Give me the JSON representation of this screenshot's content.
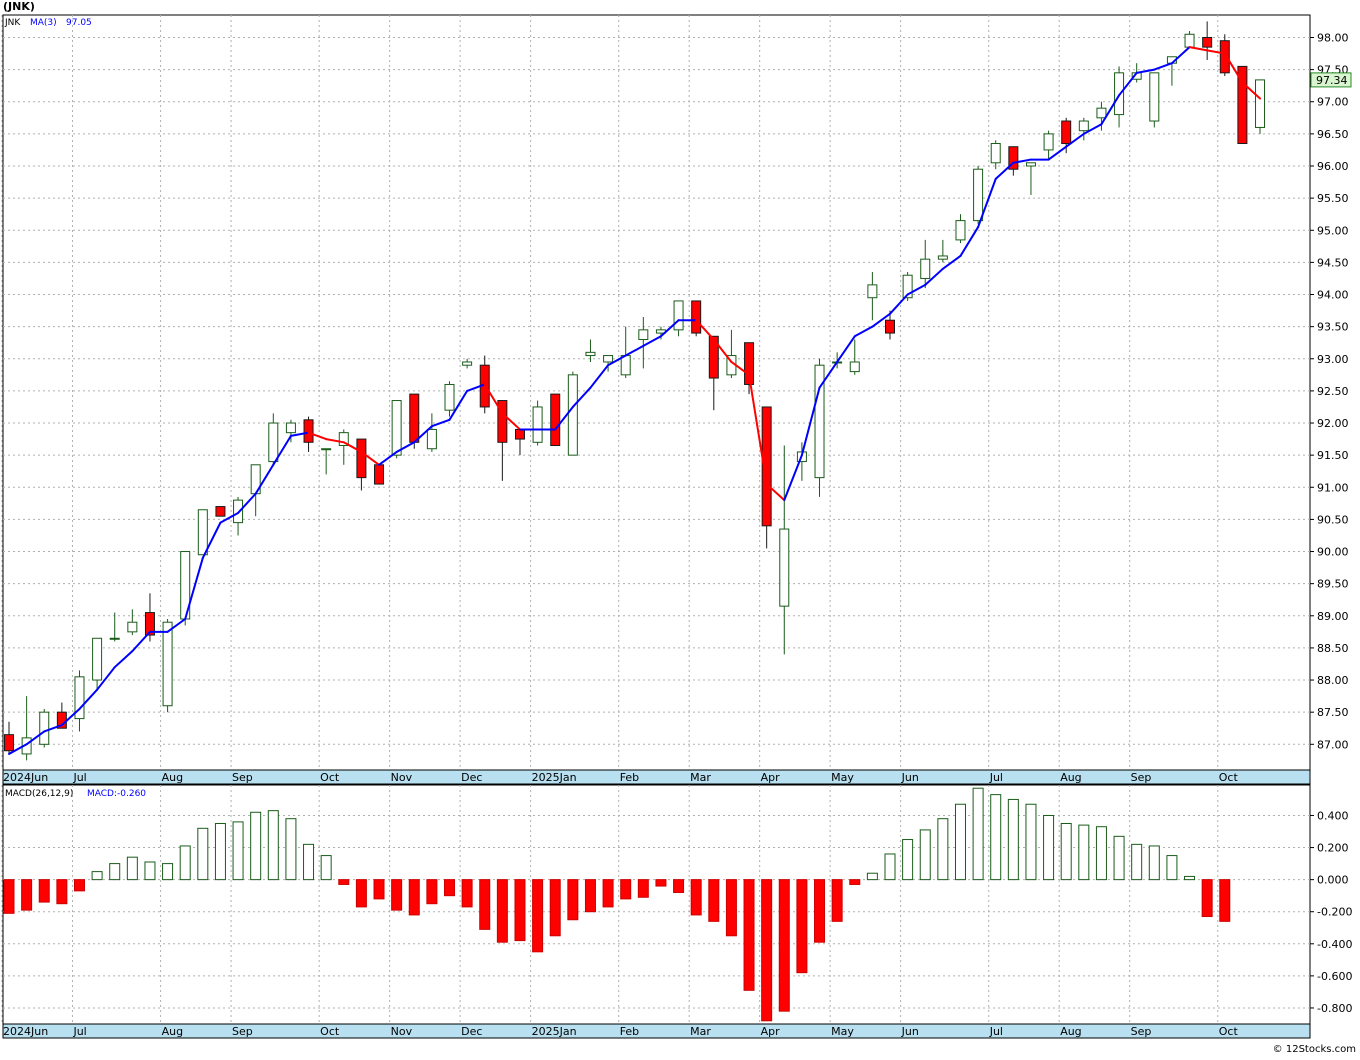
{
  "header": {
    "title": "(JNK)"
  },
  "credit": "© 12Stocks.com",
  "price_panel": {
    "legend_symbol": "JNK",
    "legend_ma": "MA(3)",
    "legend_ma_value": "97.05",
    "last_price_label": "97.34"
  },
  "macd_panel": {
    "legend_macd": "MACD(26,12,9)",
    "legend_value": "MACD:-0.260"
  },
  "colors": {
    "up_body": "#ffffff",
    "up_border": "#1a5c1a",
    "down_body": "#ff0000",
    "down_border": "#1a1a1a",
    "ma_up": "#0000ff",
    "ma_down": "#ff0000",
    "axis_strip": "#b8e0f0",
    "grid": "#b0b0b0",
    "last_price_bg": "#d8f5d0"
  },
  "time_axis": {
    "labels": [
      "2024Jun",
      "Jul",
      "Aug",
      "Sep",
      "Oct",
      "Nov",
      "Dec",
      "2025Jan",
      "Feb",
      "Mar",
      "Apr",
      "May",
      "Jun",
      "Jul",
      "Aug",
      "Sep",
      "Oct"
    ],
    "label_week_index": [
      0,
      4,
      9,
      13,
      18,
      22,
      26,
      30,
      35,
      39,
      43,
      47,
      51,
      56,
      60,
      64,
      69
    ]
  },
  "chart_data": [
    {
      "type": "candlestick",
      "title": "(JNK)",
      "series_name": "JNK",
      "period": "weekly",
      "ylim": [
        86.6,
        98.35
      ],
      "y_ticks": [
        "87.00",
        "87.50",
        "88.00",
        "88.50",
        "89.00",
        "89.50",
        "90.00",
        "90.50",
        "91.00",
        "91.50",
        "92.00",
        "92.50",
        "93.00",
        "93.50",
        "94.00",
        "94.50",
        "95.00",
        "95.50",
        "96.00",
        "96.50",
        "97.00",
        "97.50",
        "98.00"
      ],
      "grid": true,
      "candles": [
        {
          "o": 87.15,
          "h": 87.35,
          "l": 86.85,
          "c": 86.9
        },
        {
          "o": 86.85,
          "h": 87.75,
          "l": 86.75,
          "c": 87.1
        },
        {
          "o": 87.0,
          "h": 87.55,
          "l": 86.95,
          "c": 87.5
        },
        {
          "o": 87.5,
          "h": 87.65,
          "l": 87.25,
          "c": 87.25
        },
        {
          "o": 87.4,
          "h": 88.15,
          "l": 87.2,
          "c": 88.05
        },
        {
          "o": 88.0,
          "h": 88.65,
          "l": 87.85,
          "c": 88.65
        },
        {
          "o": 88.65,
          "h": 89.05,
          "l": 88.6,
          "c": 88.65
        },
        {
          "o": 88.75,
          "h": 89.1,
          "l": 88.7,
          "c": 88.9
        },
        {
          "o": 89.05,
          "h": 89.35,
          "l": 88.6,
          "c": 88.7
        },
        {
          "o": 87.6,
          "h": 88.95,
          "l": 87.5,
          "c": 88.9
        },
        {
          "o": 88.95,
          "h": 90.0,
          "l": 88.85,
          "c": 90.0
        },
        {
          "o": 89.95,
          "h": 90.65,
          "l": 89.95,
          "c": 90.65
        },
        {
          "o": 90.7,
          "h": 90.7,
          "l": 90.55,
          "c": 90.55
        },
        {
          "o": 90.45,
          "h": 90.85,
          "l": 90.25,
          "c": 90.8
        },
        {
          "o": 90.9,
          "h": 91.35,
          "l": 90.55,
          "c": 91.35
        },
        {
          "o": 91.4,
          "h": 92.15,
          "l": 91.35,
          "c": 92.0
        },
        {
          "o": 91.85,
          "h": 92.05,
          "l": 91.7,
          "c": 92.0
        },
        {
          "o": 92.05,
          "h": 92.1,
          "l": 91.55,
          "c": 91.7
        },
        {
          "o": 91.6,
          "h": 91.6,
          "l": 91.2,
          "c": 91.6
        },
        {
          "o": 91.65,
          "h": 91.9,
          "l": 91.35,
          "c": 91.85
        },
        {
          "o": 91.75,
          "h": 91.75,
          "l": 90.95,
          "c": 91.15
        },
        {
          "o": 91.35,
          "h": 91.35,
          "l": 91.05,
          "c": 91.05
        },
        {
          "o": 91.5,
          "h": 92.35,
          "l": 91.45,
          "c": 92.35
        },
        {
          "o": 92.45,
          "h": 92.45,
          "l": 91.6,
          "c": 91.7
        },
        {
          "o": 91.6,
          "h": 92.15,
          "l": 91.55,
          "c": 91.9
        },
        {
          "o": 92.2,
          "h": 92.65,
          "l": 92.1,
          "c": 92.6
        },
        {
          "o": 92.9,
          "h": 93.0,
          "l": 92.85,
          "c": 92.95
        },
        {
          "o": 92.9,
          "h": 93.05,
          "l": 92.15,
          "c": 92.25
        },
        {
          "o": 92.35,
          "h": 92.35,
          "l": 91.1,
          "c": 91.7
        },
        {
          "o": 91.9,
          "h": 91.9,
          "l": 91.5,
          "c": 91.75
        },
        {
          "o": 91.7,
          "h": 92.35,
          "l": 91.65,
          "c": 92.25
        },
        {
          "o": 92.45,
          "h": 92.45,
          "l": 91.65,
          "c": 91.65
        },
        {
          "o": 91.5,
          "h": 92.8,
          "l": 91.5,
          "c": 92.75
        },
        {
          "o": 93.05,
          "h": 93.3,
          "l": 92.95,
          "c": 93.1
        },
        {
          "o": 92.95,
          "h": 93.05,
          "l": 92.8,
          "c": 93.05
        },
        {
          "o": 92.75,
          "h": 93.5,
          "l": 92.7,
          "c": 93.05
        },
        {
          "o": 93.3,
          "h": 93.65,
          "l": 92.85,
          "c": 93.45
        },
        {
          "o": 93.4,
          "h": 93.5,
          "l": 93.3,
          "c": 93.45
        },
        {
          "o": 93.45,
          "h": 93.9,
          "l": 93.35,
          "c": 93.9
        },
        {
          "o": 93.9,
          "h": 93.9,
          "l": 93.35,
          "c": 93.4
        },
        {
          "o": 93.35,
          "h": 93.35,
          "l": 92.2,
          "c": 92.7
        },
        {
          "o": 92.75,
          "h": 93.45,
          "l": 92.7,
          "c": 93.05
        },
        {
          "o": 93.25,
          "h": 93.25,
          "l": 92.45,
          "c": 92.6
        },
        {
          "o": 92.25,
          "h": 92.25,
          "l": 90.05,
          "c": 90.4
        },
        {
          "o": 89.15,
          "h": 91.65,
          "l": 88.4,
          "c": 90.35
        },
        {
          "o": 91.4,
          "h": 91.7,
          "l": 91.1,
          "c": 91.55
        },
        {
          "o": 91.15,
          "h": 93.0,
          "l": 90.85,
          "c": 92.9
        },
        {
          "o": 92.95,
          "h": 93.1,
          "l": 92.85,
          "c": 92.95
        },
        {
          "o": 92.8,
          "h": 93.3,
          "l": 92.75,
          "c": 92.95
        },
        {
          "o": 93.95,
          "h": 94.35,
          "l": 93.6,
          "c": 94.15
        },
        {
          "o": 93.6,
          "h": 93.75,
          "l": 93.3,
          "c": 93.4
        },
        {
          "o": 93.95,
          "h": 94.35,
          "l": 93.9,
          "c": 94.3
        },
        {
          "o": 94.25,
          "h": 94.85,
          "l": 94.1,
          "c": 94.55
        },
        {
          "o": 94.55,
          "h": 94.85,
          "l": 94.5,
          "c": 94.6
        },
        {
          "o": 94.85,
          "h": 95.25,
          "l": 94.8,
          "c": 95.15
        },
        {
          "o": 95.15,
          "h": 96.0,
          "l": 95.1,
          "c": 95.95
        },
        {
          "o": 96.05,
          "h": 96.4,
          "l": 95.95,
          "c": 96.35
        },
        {
          "o": 96.3,
          "h": 96.3,
          "l": 95.85,
          "c": 95.95
        },
        {
          "o": 96.0,
          "h": 96.05,
          "l": 95.55,
          "c": 96.05
        },
        {
          "o": 96.25,
          "h": 96.55,
          "l": 96.1,
          "c": 96.5
        },
        {
          "o": 96.7,
          "h": 96.75,
          "l": 96.2,
          "c": 96.35
        },
        {
          "o": 96.55,
          "h": 96.75,
          "l": 96.4,
          "c": 96.7
        },
        {
          "o": 96.75,
          "h": 97.0,
          "l": 96.55,
          "c": 96.9
        },
        {
          "o": 96.8,
          "h": 97.55,
          "l": 96.6,
          "c": 97.45
        },
        {
          "o": 97.35,
          "h": 97.6,
          "l": 97.3,
          "c": 97.45
        },
        {
          "o": 96.7,
          "h": 97.45,
          "l": 96.6,
          "c": 97.45
        },
        {
          "o": 97.6,
          "h": 97.7,
          "l": 97.25,
          "c": 97.7
        },
        {
          "o": 97.85,
          "h": 98.1,
          "l": 97.85,
          "c": 98.05
        },
        {
          "o": 98.0,
          "h": 98.25,
          "l": 97.65,
          "c": 97.85
        },
        {
          "o": 97.95,
          "h": 98.05,
          "l": 97.4,
          "c": 97.45
        },
        {
          "o": 97.55,
          "h": 97.55,
          "l": 96.35,
          "c": 96.35
        },
        {
          "o": 96.6,
          "h": 97.34,
          "l": 96.5,
          "c": 97.34
        }
      ],
      "ma3": [
        86.85,
        87.0,
        87.2,
        87.3,
        87.55,
        87.85,
        88.2,
        88.45,
        88.75,
        88.75,
        88.95,
        89.9,
        90.45,
        90.6,
        90.9,
        91.35,
        91.8,
        91.85,
        91.75,
        91.7,
        91.55,
        91.35,
        91.55,
        91.7,
        91.95,
        92.05,
        92.5,
        92.6,
        92.15,
        91.9,
        91.9,
        91.9,
        92.25,
        92.55,
        92.9,
        93.05,
        93.2,
        93.35,
        93.6,
        93.6,
        93.3,
        92.95,
        92.75,
        91.05,
        90.8,
        91.5,
        92.55,
        92.95,
        93.35,
        93.5,
        93.7,
        94.0,
        94.15,
        94.4,
        94.6,
        95.05,
        95.8,
        96.05,
        96.1,
        96.1,
        96.3,
        96.5,
        96.65,
        97.1,
        97.45,
        97.5,
        97.6,
        97.85,
        97.8,
        97.75,
        97.3,
        97.05
      ]
    },
    {
      "type": "bar",
      "title": "MACD(26,12,9)",
      "series_name": "MACD",
      "ylim": [
        -0.9,
        0.59
      ],
      "y_ticks": [
        "0.400",
        "0.200",
        "0.000",
        "-0.200",
        "-0.400",
        "-0.600",
        "-0.800"
      ],
      "y_tick_values": [
        0.4,
        0.2,
        0.0,
        -0.2,
        -0.4,
        -0.6,
        -0.8
      ],
      "values": [
        -0.21,
        -0.19,
        -0.14,
        -0.15,
        -0.07,
        0.05,
        0.1,
        0.14,
        0.11,
        0.1,
        0.21,
        0.32,
        0.35,
        0.36,
        0.42,
        0.43,
        0.38,
        0.22,
        0.15,
        -0.03,
        -0.17,
        -0.12,
        -0.19,
        -0.22,
        -0.15,
        -0.1,
        -0.17,
        -0.31,
        -0.39,
        -0.38,
        -0.45,
        -0.35,
        -0.25,
        -0.2,
        -0.17,
        -0.12,
        -0.11,
        -0.04,
        -0.08,
        -0.22,
        -0.26,
        -0.35,
        -0.69,
        -0.88,
        -0.82,
        -0.58,
        -0.39,
        -0.26,
        -0.03,
        0.04,
        0.16,
        0.25,
        0.31,
        0.38,
        0.47,
        0.57,
        0.53,
        0.5,
        0.47,
        0.4,
        0.35,
        0.34,
        0.33,
        0.27,
        0.22,
        0.21,
        0.15,
        0.02,
        -0.23,
        -0.26
      ]
    }
  ]
}
